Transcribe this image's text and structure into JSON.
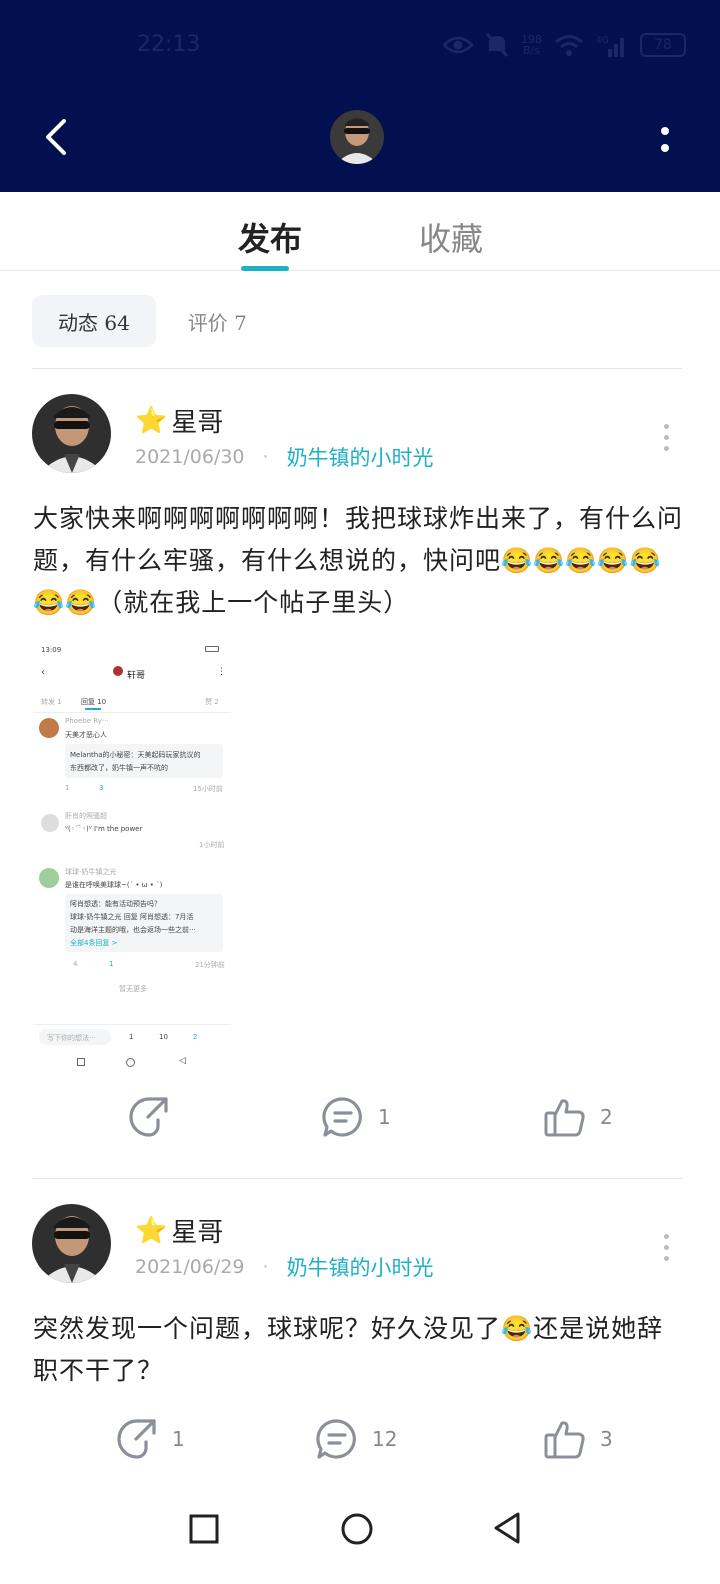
{
  "status": {
    "time": "22:13",
    "net_speed_top": "198",
    "net_speed_bottom": "B/s",
    "network": "4G",
    "battery": "78"
  },
  "tabs": {
    "published": "发布",
    "favorites": "收藏"
  },
  "subtabs": {
    "dynamic": "动态 64",
    "reviews": "评价 7"
  },
  "posts": [
    {
      "author": "星哥",
      "date": "2021/06/30",
      "topic": "奶牛镇的小时光",
      "text": "大家快来啊啊啊啊啊啊啊！我把球球炸出来了，有什么问题，有什么牢骚，有什么想说的，快问吧😂😂😂😂😂😂😂（就在我上一个帖子里头）",
      "share": "",
      "comments": "1",
      "likes": "2"
    },
    {
      "author": "星哥",
      "date": "2021/06/29",
      "topic": "奶牛镇的小时光",
      "text": "突然发现一个问题，球球呢？好久没见了😂还是说她辞职不干了？",
      "share": "1",
      "comments": "12",
      "likes": "3"
    }
  ],
  "thumbnail": {
    "time": "13:09",
    "title": "轩哥",
    "tab1": "转发 1",
    "tab2": "回复 10",
    "tab3": "赞 2",
    "c1_name": "Phoebe Ry···",
    "c1_text": "天美才恶心人",
    "c1_quote1": "Melantha的小秘密：天美起码玩家抗议的",
    "c1_quote2": "东西都改了，奶牛镇一声不吭的",
    "c1_reply": "1",
    "c1_like": "3",
    "c1_time": "15小时前",
    "c2_name": "肝肖的照骚超",
    "c2_text": "ⱽ(◦´`◦)ⱽ I'm the power",
    "c2_time": "1小时前",
    "c3_name": "球球-奶牛镇之光",
    "c3_text": "是谁在呼唤美球球~(ˊ • ω • ˋ)",
    "c3_q1": "阿肖想透：能有活动预告吗？",
    "c3_q2": "球球-奶牛镇之光 回复 阿肖想透：7月活",
    "c3_q3": "动是海洋主题的哦，也会返场一些之前···",
    "c3_more": "全部4条回复 >",
    "c3_reply": "4",
    "c3_like": "1",
    "c3_time": "21分钟前",
    "end": "暂无更多",
    "input_placeholder": "写下你的想法···",
    "bar_share": "1",
    "bar_comment": "10",
    "bar_like": "2"
  },
  "colors": {
    "header_bg": "#03104f",
    "accent": "#1db0c7"
  }
}
